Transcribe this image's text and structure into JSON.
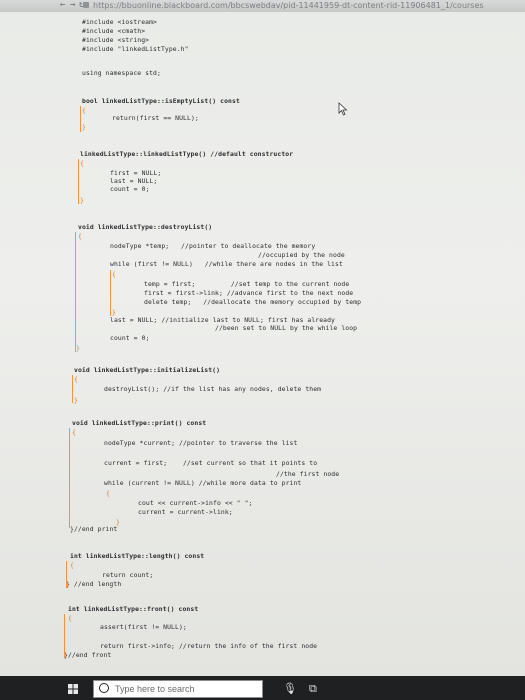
{
  "browser": {
    "url": "https://bbuonline.blackboard.com/bbcswebdav/pid-11441959-dt-content-rid-11906481_1/courses"
  },
  "code_lines": [
    {
      "text": "#include <iostream>",
      "x": 0,
      "y": 0
    },
    {
      "text": "#include <cmath>",
      "x": 0,
      "y": 1
    },
    {
      "text": "#include <string>",
      "x": 0,
      "y": 2
    },
    {
      "text": "#include \"linkedListType.h\"",
      "x": 0,
      "y": 3
    }
  ],
  "code": {
    "inc1": "#include <iostream>",
    "inc2": "#include <cmath>",
    "inc3": "#include <string>",
    "inc4": "#include \"linkedListType.h\"",
    "using": "using namespace std;",
    "isEmpty_sig": "bool linkedListType::isEmptyList() const",
    "open1": "{",
    "isEmpty_ret": "return(first == NULL);",
    "close1": "}",
    "ctor_sig": "linkedListType::linkedListType() //default constructor",
    "open2": "{",
    "ctor_first": "first = NULL;",
    "ctor_last": "last = NULL;",
    "ctor_count": "count = 0;",
    "close2": "}",
    "destroy_sig": "void linkedListType::destroyList()",
    "open3": "{",
    "destroy_decl": "nodeType *temp;   //pointer to deallocate the memory",
    "destroy_decl2": "//occupied by the node",
    "destroy_while": "while (first != NULL)   //while there are nodes in the list",
    "open3b": "{",
    "destroy_temp": "temp = first;         //set temp to the current node",
    "destroy_adv": "first = first->link; //advance first to the next node",
    "destroy_del": "delete temp;   //deallocate the memory occupied by temp",
    "close3b": "}",
    "destroy_last": "last = NULL; //initialize last to NULL; first has already",
    "destroy_last2": "//been set to NULL by the while loop",
    "destroy_count": "count = 0;",
    "close3": "}",
    "init_sig": "void linkedListType::initializeList()",
    "open4": "{",
    "init_body": "destroyList(); //if the list has any nodes, delete them",
    "close4": "}",
    "print_sig": "void linkedListType::print() const",
    "open5": "{",
    "print_decl": "nodeType *current; //pointer to traverse the list",
    "print_cur": "current = first;    //set current so that it points to",
    "print_cur2": "//the first node",
    "print_while": "while (current != NULL) //while more data to print",
    "open5b": "{",
    "print_cout": "cout << current->info << \" \";",
    "print_adv": "current = current->link;",
    "close5b": "}",
    "print_end": "}//end print",
    "length_sig": "int linkedListType::length() const",
    "open6": "{",
    "length_ret": "return count;",
    "length_end": "} //end length",
    "front_sig": "int linkedListType::front() const",
    "open7": "{",
    "front_assert": "assert(first != NULL);",
    "front_ret": "return first->info; //return the info of the first node",
    "front_end": "}//end front"
  },
  "taskbar": {
    "search_placeholder": "Type here to search"
  }
}
